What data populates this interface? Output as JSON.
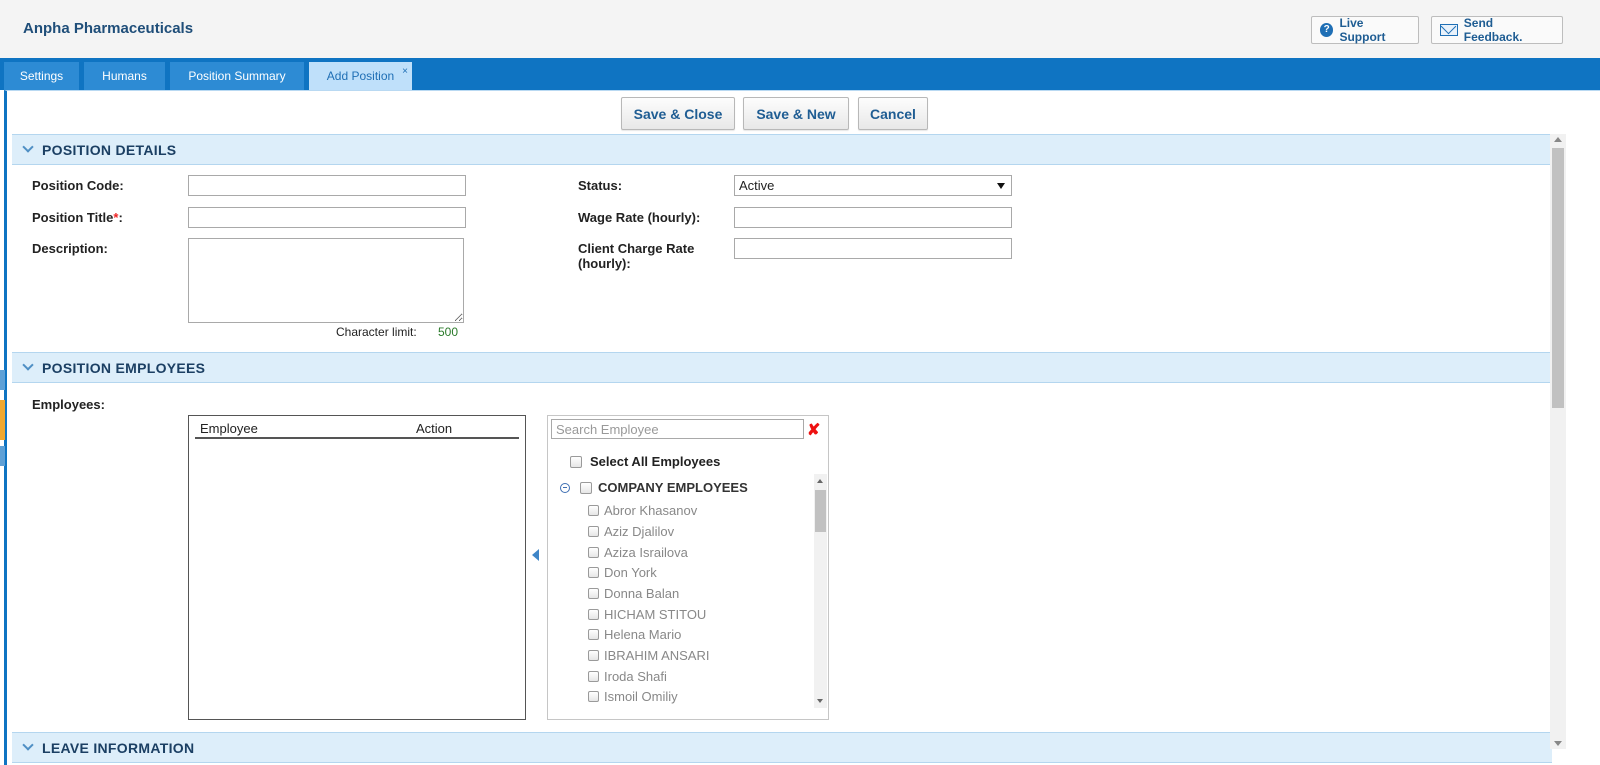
{
  "app": {
    "title": "Anpha Pharmaceuticals"
  },
  "top_actions": {
    "live_support": "Live Support",
    "send_feedback": "Send Feedback."
  },
  "tabs": [
    {
      "label": "Settings"
    },
    {
      "label": "Humans"
    },
    {
      "label": "Position Summary"
    },
    {
      "label": "Add Position",
      "close": "×"
    }
  ],
  "toolbar": {
    "save_close": "Save & Close",
    "save_new": "Save & New",
    "cancel": "Cancel"
  },
  "position_details": {
    "title": "POSITION DETAILS",
    "position_code_label": "Position Code:",
    "position_title_label": "Position Title",
    "required_mark": "*",
    "position_title_colon": ":",
    "description_label": "Description:",
    "char_limit_label": "Character limit:",
    "char_limit_value": "500",
    "status_label": "Status:",
    "status_value": "Active",
    "wage_rate_label": "Wage Rate (hourly):",
    "client_charge_label_line1": "Client Charge Rate",
    "client_charge_label_line2": "(hourly):"
  },
  "position_employees": {
    "title": "POSITION EMPLOYEES",
    "employees_label": "Employees:",
    "table_headers": {
      "employee": "Employee",
      "action": "Action"
    },
    "search_placeholder": "Search Employee",
    "select_all": "Select All Employees",
    "group": "COMPANY EMPLOYEES",
    "employees": [
      "Abror Khasanov",
      "Aziz Djalilov",
      "Aziza Israilova",
      "Don York",
      "Donna Balan",
      "HICHAM STITOU",
      "Helena Mario",
      "IBRAHIM ANSARI",
      "Iroda Shafi",
      "Ismoil Omiliy"
    ]
  },
  "leave_information": {
    "title": "LEAVE INFORMATION"
  }
}
